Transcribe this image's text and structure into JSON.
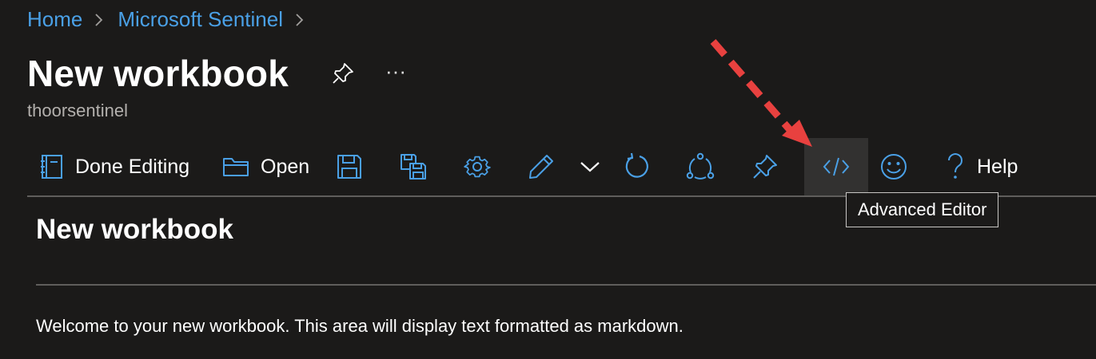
{
  "breadcrumb": {
    "items": [
      "Home",
      "Microsoft Sentinel"
    ]
  },
  "header": {
    "title": "New workbook",
    "subtitle": "thoorsentinel",
    "more_label": "···"
  },
  "toolbar": {
    "done_editing_label": "Done Editing",
    "open_label": "Open",
    "help_label": "Help",
    "icons": [
      "notebook-icon",
      "folder-icon",
      "save-icon",
      "save-as-icon",
      "gear-icon",
      "pencil-icon",
      "chevron-down-icon",
      "refresh-icon",
      "share-icon",
      "pin-icon",
      "code-icon",
      "smiley-icon",
      "question-icon"
    ]
  },
  "tooltip": {
    "text": "Advanced Editor"
  },
  "content": {
    "heading": "New workbook",
    "body": "Welcome to your new workbook. This area will display text formatted as markdown."
  },
  "colors": {
    "background": "#1b1a19",
    "accent": "#4aa0e6",
    "annotation_arrow": "#e8413f"
  }
}
